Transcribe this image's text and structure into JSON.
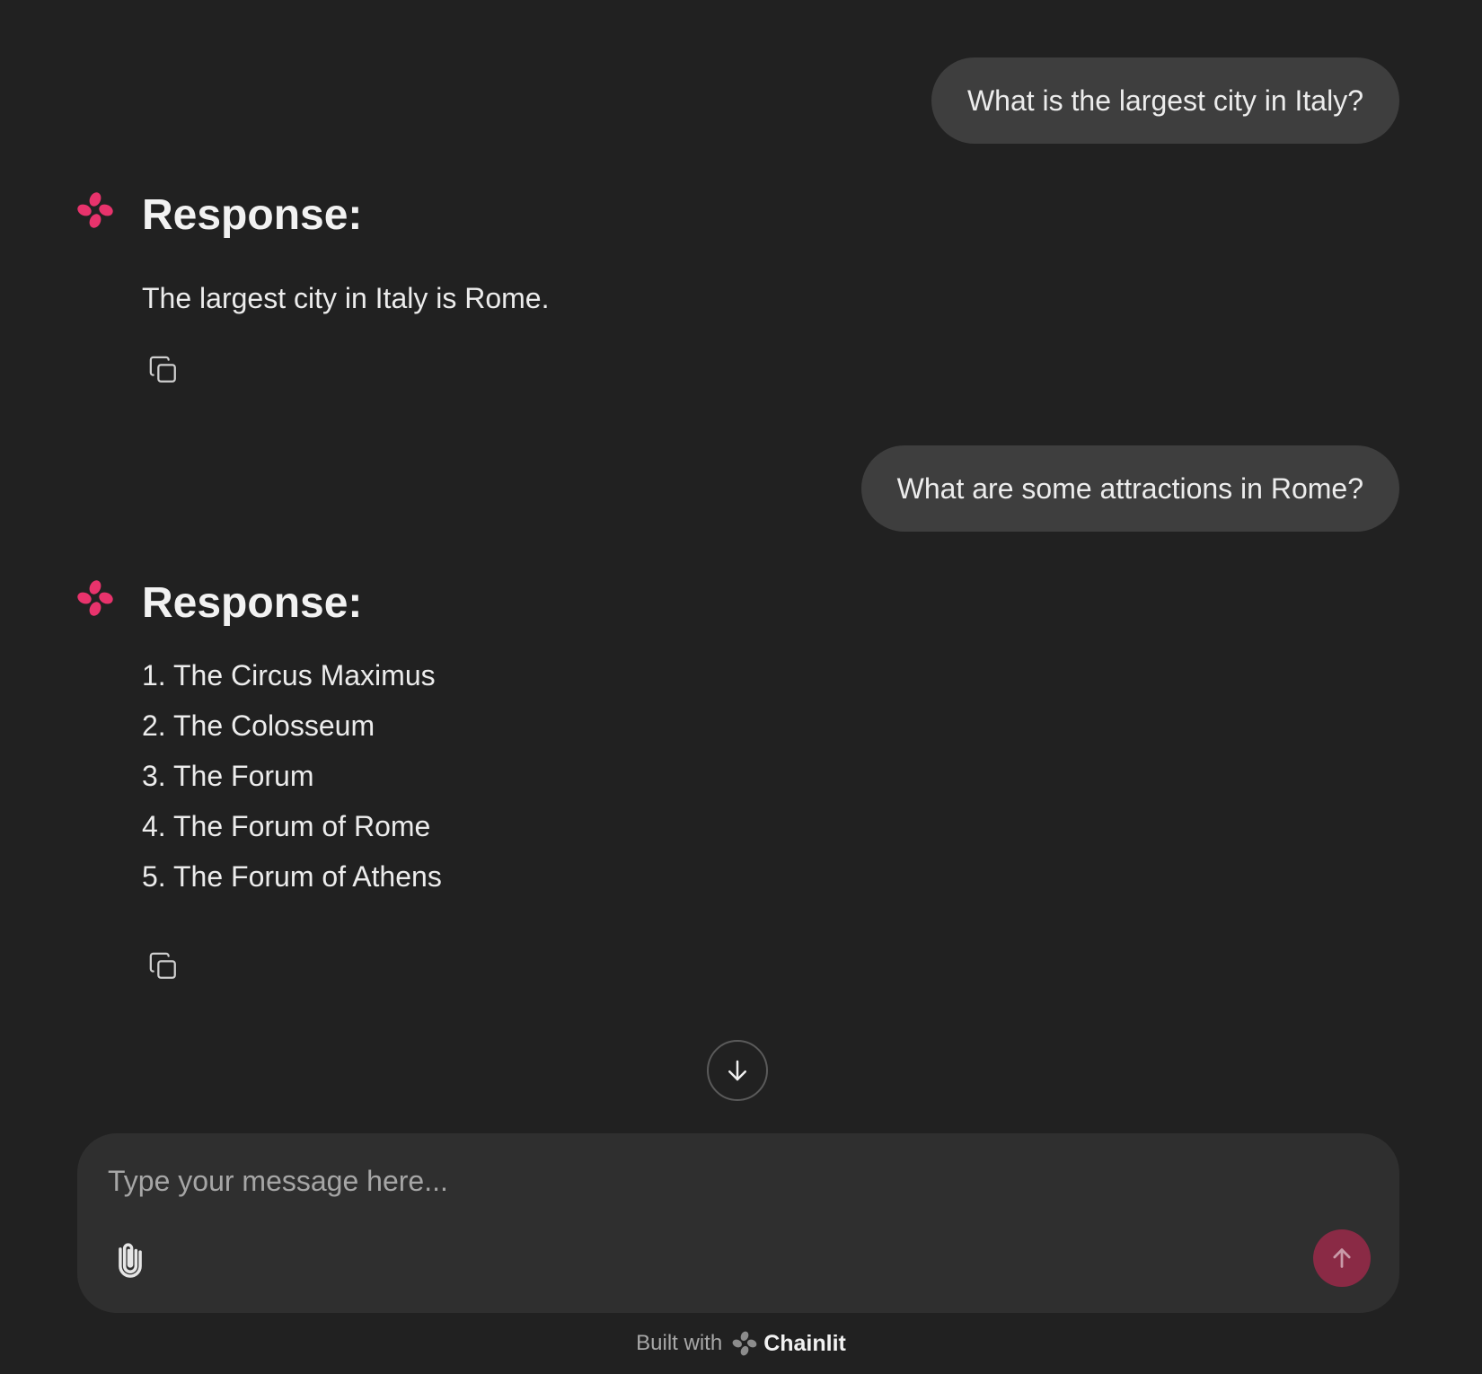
{
  "messages": [
    {
      "role": "user",
      "text": "What is the largest city in Italy?"
    },
    {
      "role": "assistant",
      "heading": "Response:",
      "text": "The largest city in Italy is Rome."
    },
    {
      "role": "user",
      "text": "What are some attractions in Rome?"
    },
    {
      "role": "assistant",
      "heading": "Response:",
      "list": [
        "1. The Circus Maximus",
        "2. The Colosseum",
        "3. The Forum",
        "4. The Forum of Rome",
        "5. The Forum of Athens"
      ]
    }
  ],
  "composer": {
    "placeholder": "Type your message here..."
  },
  "footer": {
    "prefix": "Built with",
    "brand": "Chainlit"
  },
  "icons": {
    "avatar": "chainlit-logo-icon",
    "copy": "copy-icon",
    "scroll": "arrow-down-icon",
    "attach": "paperclip-icon",
    "send": "arrow-up-icon"
  },
  "colors": {
    "background": "#212121",
    "user_bubble": "#3e3e3e",
    "composer": "#2f2f2f",
    "accent": "#e8336c",
    "send_button": "#8a2a45"
  }
}
